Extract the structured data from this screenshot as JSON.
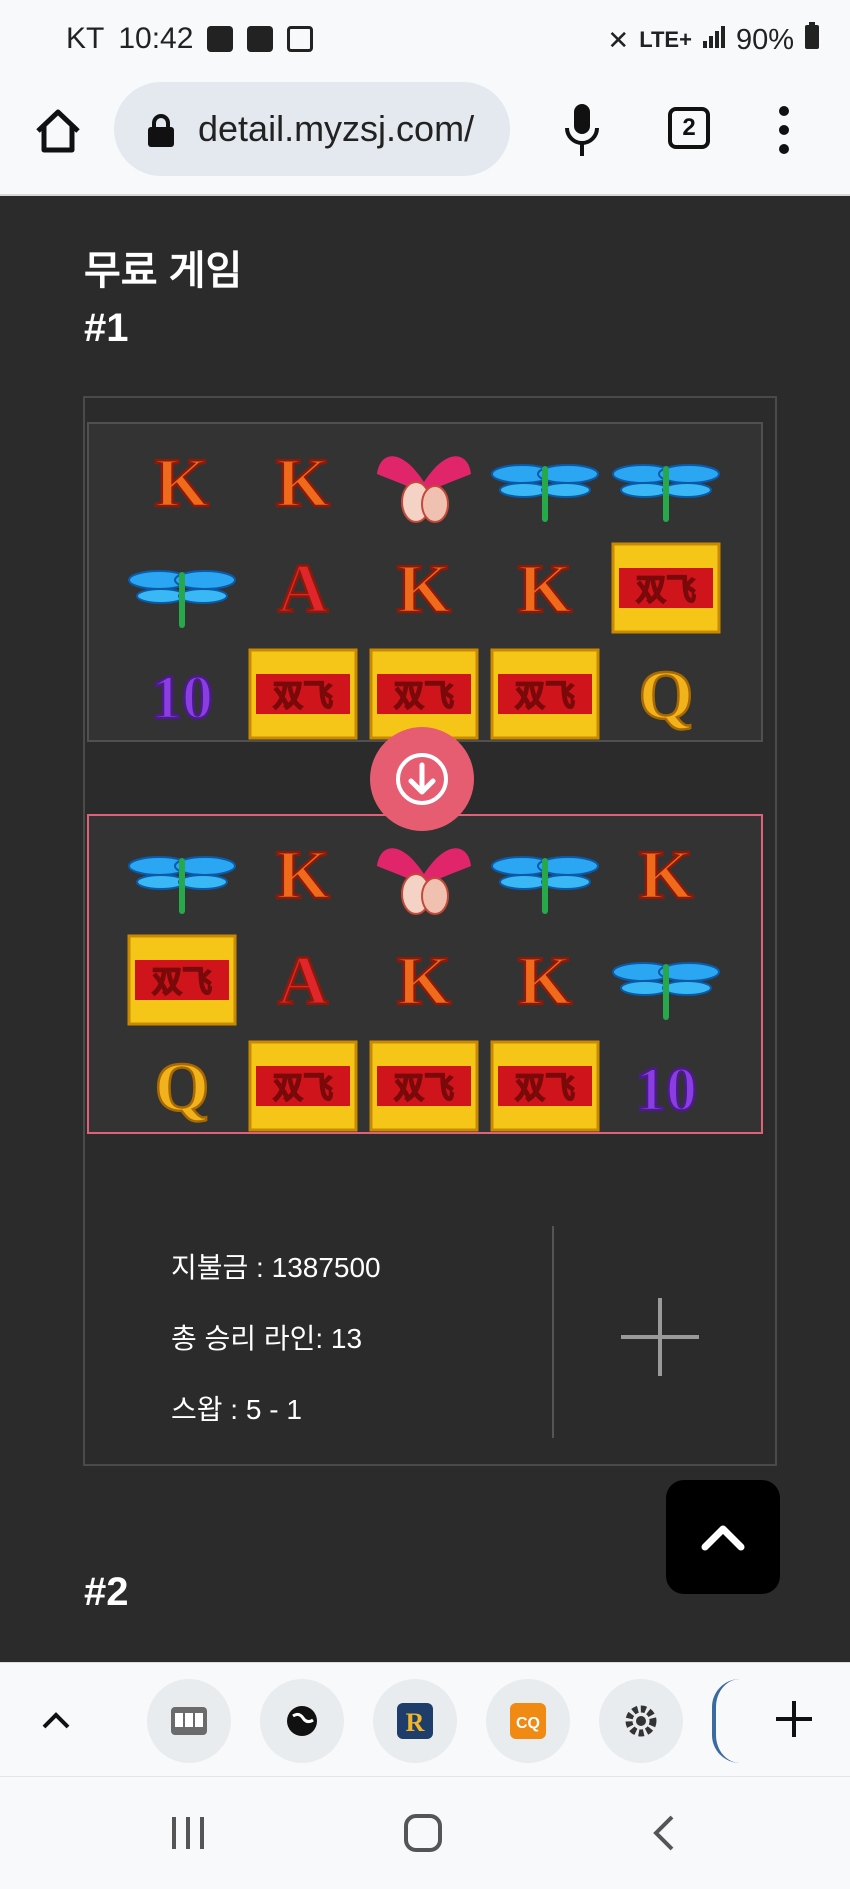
{
  "status_bar": {
    "carrier": "KT",
    "time": "10:42",
    "battery": "90%",
    "network": "LTE+"
  },
  "browser": {
    "url": "detail.myzsj.com/",
    "tab_count": "2"
  },
  "section_title": "무료 게임",
  "games": [
    {
      "id": "#1",
      "before_grid": [
        [
          "K",
          "K",
          "phoenix",
          "dragonfly",
          "dragonfly"
        ],
        [
          "dragonfly",
          "A",
          "K",
          "K",
          "双飞"
        ],
        [
          "10",
          "双飞",
          "双飞",
          "双飞",
          "Q"
        ]
      ],
      "after_grid": [
        [
          "dragonfly",
          "K",
          "phoenix",
          "dragonfly",
          "K"
        ],
        [
          "双飞",
          "A",
          "K",
          "K",
          "dragonfly"
        ],
        [
          "Q",
          "双飞",
          "双飞",
          "双飞",
          "10"
        ]
      ],
      "payout": "지불금 : 1387500",
      "win_lines": "총 승리 라인: 13",
      "swap": "스왑 : 5 - 1"
    },
    {
      "id": "#2"
    }
  ],
  "bottom_bar": {
    "items": [
      "chevron-up-icon",
      "slot-machine-icon",
      "globe-icon",
      "r-app-icon",
      "cq-app-icon",
      "settings-icon",
      "partial-app-icon",
      "plus-icon"
    ]
  },
  "colors": {
    "accent": "#e65d71",
    "background": "#2b2b2b",
    "card_border": "#4a4a4a"
  }
}
